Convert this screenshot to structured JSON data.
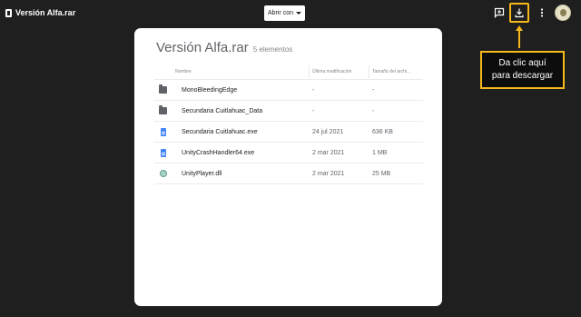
{
  "header": {
    "title": "Versión Alfa.rar",
    "open_with": "Abrir con",
    "icons": [
      "file-icon",
      "add-comment-icon",
      "download-icon",
      "more-vert-icon",
      "avatar"
    ]
  },
  "callout": {
    "line1": "Da clic aquí",
    "line2": "para descargar",
    "color": "#f6b81a"
  },
  "archive": {
    "name": "Versión Alfa.rar",
    "count": "5 elementos",
    "columns": {
      "name": "Nombre",
      "modified": "Última modificación",
      "size": "Tamaño del archi..."
    },
    "rows": [
      {
        "icon": "folder-icon",
        "name": "MonoBleedingEdge",
        "modified": "-",
        "size": "-"
      },
      {
        "icon": "folder-icon",
        "name": "Secundaria Cuitlahuac_Data",
        "modified": "-",
        "size": "-"
      },
      {
        "icon": "document-icon",
        "name": "Secundaria Cuitlahuac.exe",
        "modified": "24 jul 2021",
        "size": "636 KB"
      },
      {
        "icon": "document-icon",
        "name": "UnityCrashHandler64.exe",
        "modified": "2 mar 2021",
        "size": "1 MB"
      },
      {
        "icon": "globe-icon",
        "name": "UnityPlayer.dll",
        "modified": "2 mar 2021",
        "size": "25 MB"
      }
    ]
  }
}
